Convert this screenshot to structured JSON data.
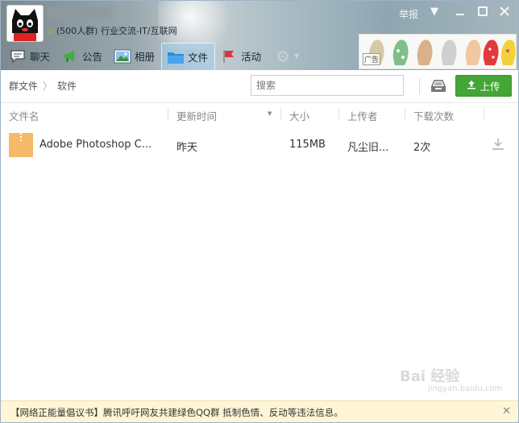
{
  "header": {
    "group_info": "(500人群) 行业交流-IT/互联网",
    "report": "举报",
    "ad_label": "广告",
    "tabs": [
      {
        "label": "聊天",
        "icon": "chat-bubble-icon"
      },
      {
        "label": "公告",
        "icon": "megaphone-icon"
      },
      {
        "label": "相册",
        "icon": "photo-icon"
      },
      {
        "label": "文件",
        "icon": "folder-icon",
        "active": true
      },
      {
        "label": "活动",
        "icon": "flag-icon"
      }
    ]
  },
  "toolbar": {
    "breadcrumb_root": "群文件",
    "breadcrumb_current": "软件",
    "search_placeholder": "搜索",
    "upload_label": "上传"
  },
  "table": {
    "columns": [
      "文件名",
      "更新时间",
      "大小",
      "上传者",
      "下载次数"
    ],
    "rows": [
      {
        "name": "Adobe Photoshop C...",
        "updated": "昨天",
        "size": "115MB",
        "uploader": "凡尘旧...",
        "downloads": "2次"
      }
    ]
  },
  "footer": {
    "notice": "【网络正能量倡议书】腾讯呼吁网友共建绿色QQ群 抵制色情、反动等违法信息。"
  },
  "watermark": {
    "text": "Bai 经验",
    "sub": "jingyan.baidu.com"
  },
  "colors": {
    "upload_green": "#43a636",
    "footer_bg": "#fff6d6",
    "file_icon": "#f5b968"
  }
}
